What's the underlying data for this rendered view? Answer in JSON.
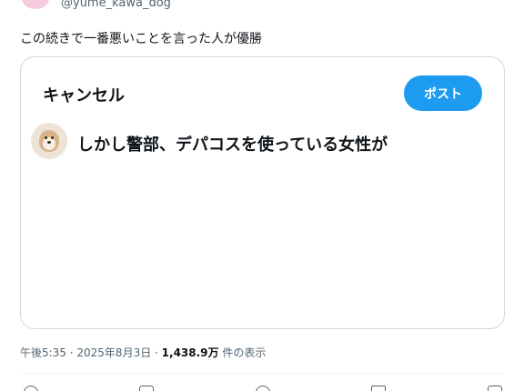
{
  "author": {
    "handle": "@yume_kawa_dog"
  },
  "tweet": {
    "text": "この続きで一番悪いことを言った人が優勝"
  },
  "compose": {
    "cancel_label": "キャンセル",
    "post_label": "ポスト",
    "draft_text": "しかし警部、デパコスを使っている女性が"
  },
  "meta": {
    "timestamp": "午後5:35 · 2025年8月3日 · ",
    "views_count": "1,438.9万",
    "views_label": " 件の表示"
  },
  "colors": {
    "accent": "#1d9bf0",
    "secondary_text": "#536471",
    "border": "#cfd9de"
  },
  "icons": [
    "avatar",
    "dog-avatar",
    "reply-icon",
    "repost-icon",
    "like-icon",
    "views-icon",
    "share-icon"
  ]
}
